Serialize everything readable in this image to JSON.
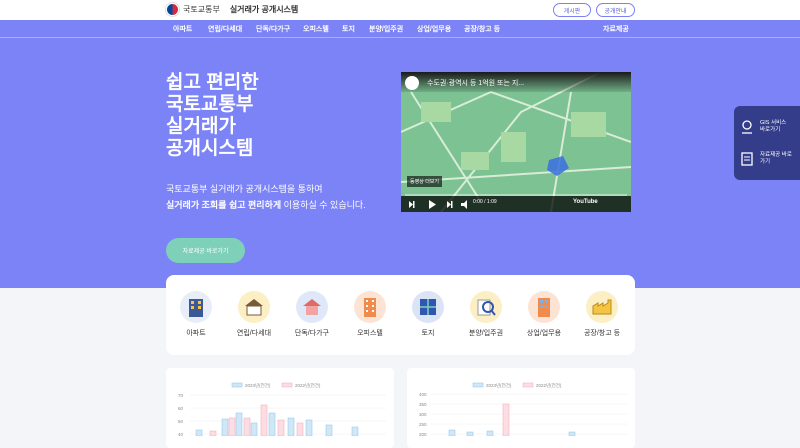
{
  "header": {
    "ministry": "국토교통부",
    "system_name": "실거래가 공개시스템",
    "btn_notice": "게시판",
    "btn_guide": "공개안내"
  },
  "nav": {
    "items": [
      "아파트",
      "연립/다세대",
      "단독/다가구",
      "오피스텔",
      "토지",
      "분양/입주권",
      "상업/업무용",
      "공장/창고 등"
    ],
    "right": "자료제공"
  },
  "hero": {
    "title_lines": [
      "쉽고 편리한",
      "국토교통부",
      "실거래가",
      "공개시스템"
    ],
    "desc_line1": "국토교통부 실거래가 공개시스템을 통하여",
    "desc_line2_bold": "실거래가 조회를 쉽고 편리하게",
    "desc_line2_rest": " 이용하실 수 있습니다.",
    "cta": "자료제공 바로가기"
  },
  "video": {
    "title": "수도권·광역시 등 1억원 또는 지...",
    "tag": "동영상 더보기",
    "time": "0:00 / 1:09",
    "brand": "YouTube"
  },
  "quick": {
    "gis": "GIS 서비스 바로가기",
    "data": "자료제공 바로가기"
  },
  "categories": [
    {
      "label": "아파트",
      "color": "#3b5998",
      "icon": "apartment-icon"
    },
    {
      "label": "연립/다세대",
      "color": "#f5c542",
      "icon": "villa-icon"
    },
    {
      "label": "단독/다가구",
      "color": "#4a7bd0",
      "icon": "house-icon"
    },
    {
      "label": "오피스텔",
      "color": "#f08b4b",
      "icon": "officetel-icon"
    },
    {
      "label": "토지",
      "color": "#2f56b0",
      "icon": "land-icon"
    },
    {
      "label": "분양/입주권",
      "color": "#f5c542",
      "icon": "presale-icon"
    },
    {
      "label": "상업/업무용",
      "color": "#f08b4b",
      "icon": "commercial-icon"
    },
    {
      "label": "공장/창고 등",
      "color": "#f5c542",
      "icon": "factory-icon"
    }
  ],
  "chart_left": {
    "legend_a": "2023년(전건)",
    "legend_b": "2022년(전건)",
    "y_ticks": [
      "70",
      "60",
      "50",
      "40"
    ]
  },
  "chart_right": {
    "legend_a": "2023년(전건)",
    "legend_b": "2022년(전건)",
    "y_ticks": [
      "400",
      "350",
      "300",
      "250",
      "200"
    ]
  }
}
